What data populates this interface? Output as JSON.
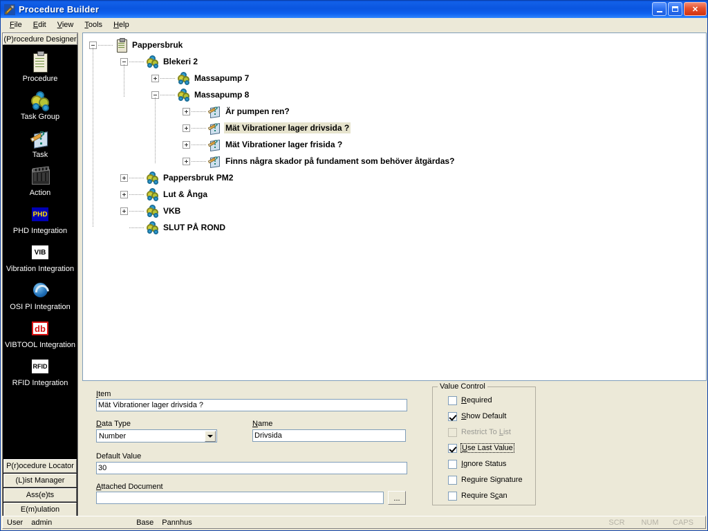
{
  "window": {
    "title": "Procedure Builder",
    "icon": "hammer-wrench-icon",
    "minimize_label": "Minimize",
    "maximize_label": "Restore",
    "close_label": "Close"
  },
  "menu": {
    "items": [
      {
        "name": "file",
        "label": "File",
        "accel": "F"
      },
      {
        "name": "edit",
        "label": "Edit",
        "accel": "E"
      },
      {
        "name": "view",
        "label": "View",
        "accel": "V"
      },
      {
        "name": "tools",
        "label": "Tools",
        "accel": "T"
      },
      {
        "name": "help",
        "label": "Help",
        "accel": "H"
      }
    ]
  },
  "sidebar": {
    "header": "(P)rocedure Designer",
    "items": [
      {
        "label": "Procedure",
        "icon": "procedure-clipboard-icon"
      },
      {
        "label": "Task Group",
        "icon": "task-group-gears-icon"
      },
      {
        "label": "Task",
        "icon": "task-pencil-question-icon"
      },
      {
        "label": "Action",
        "icon": "action-clapperboard-icon"
      },
      {
        "label": "PHD Integration",
        "icon": "phd-badge-icon"
      },
      {
        "label": "Vibration Integration",
        "icon": "vib-badge-icon"
      },
      {
        "label": "OSI PI Integration",
        "icon": "osi-pi-icon"
      },
      {
        "label": "VIBTOOL Integration",
        "icon": "db-badge-icon"
      },
      {
        "label": "RFID Integration",
        "icon": "rfid-badge-icon"
      }
    ],
    "footer_buttons": [
      {
        "label": "P(r)ocedure Locator"
      },
      {
        "label": "(L)ist Manager"
      },
      {
        "label": "Ass(e)ts"
      },
      {
        "label": "E(m)ulation"
      }
    ]
  },
  "tree": {
    "nodes": [
      {
        "label": "Pappersbruk",
        "depth": 0,
        "state": "expanded",
        "icon": "procedure-clipboard-icon",
        "selected": false
      },
      {
        "label": "Blekeri 2",
        "depth": 1,
        "state": "expanded",
        "icon": "task-group-gears-icon",
        "selected": false
      },
      {
        "label": "Massapump 7",
        "depth": 2,
        "state": "collapsed",
        "icon": "task-group-gears-icon",
        "selected": false
      },
      {
        "label": "Massapump 8",
        "depth": 2,
        "state": "expanded",
        "icon": "task-group-gears-icon",
        "selected": false
      },
      {
        "label": "Är pumpen ren?",
        "depth": 3,
        "state": "collapsed",
        "icon": "task-pencil-question-icon",
        "selected": false
      },
      {
        "label": "Mät Vibrationer lager drivsida ?",
        "depth": 3,
        "state": "collapsed",
        "icon": "task-pencil-question-icon",
        "selected": true
      },
      {
        "label": "Mät Vibrationer lager frisida ?",
        "depth": 3,
        "state": "collapsed",
        "icon": "task-pencil-question-icon",
        "selected": false
      },
      {
        "label": "Finns några skador på fundament som behöver åtgärdas?",
        "depth": 3,
        "state": "collapsed",
        "icon": "task-pencil-question-icon",
        "selected": false
      },
      {
        "label": "Pappersbruk PM2",
        "depth": 1,
        "state": "collapsed",
        "icon": "task-group-gears-icon",
        "selected": false
      },
      {
        "label": "Lut & Ånga",
        "depth": 1,
        "state": "collapsed",
        "icon": "task-group-gears-icon",
        "selected": false
      },
      {
        "label": "VKB",
        "depth": 1,
        "state": "collapsed",
        "icon": "task-group-gears-icon",
        "selected": false
      },
      {
        "label": "SLUT PÅ ROND",
        "depth": 1,
        "state": "leaf",
        "icon": "task-group-gears-icon",
        "selected": false
      }
    ]
  },
  "form": {
    "item_label": "Item",
    "item_accel": "I",
    "item_value": "Mät Vibrationer lager drivsida ?",
    "data_type_label": "Data Type",
    "data_type_accel": "D",
    "data_type_value": "Number",
    "name_label": "Name",
    "name_accel": "N",
    "name_value": "Drivsida",
    "default_value_label": "Default Value",
    "default_value": "30",
    "attached_document_label": "Attached Document",
    "attached_document_accel": "A",
    "attached_document_value": "",
    "browse_label": "..."
  },
  "value_control": {
    "title": "Value Control",
    "checkboxes": [
      {
        "label": "Required",
        "accel": "R",
        "checked": false,
        "disabled": false,
        "focused": false
      },
      {
        "label": "Show Default",
        "accel": "S",
        "checked": true,
        "disabled": false,
        "focused": false
      },
      {
        "label": "Restrict To List",
        "accel": "L",
        "checked": false,
        "disabled": true,
        "focused": false
      },
      {
        "label": "Use Last Value",
        "accel": "U",
        "checked": true,
        "disabled": false,
        "focused": true
      },
      {
        "label": "Ignore Status",
        "accel": "I",
        "checked": false,
        "disabled": false,
        "focused": false
      },
      {
        "label": "Require Signature",
        "accel": "q",
        "checked": false,
        "disabled": false,
        "focused": false
      },
      {
        "label": "Require Scan",
        "accel": "c",
        "checked": false,
        "disabled": false,
        "focused": false
      }
    ]
  },
  "statusbar": {
    "user_label": "User",
    "user_value": "admin",
    "base_label": "Base",
    "base_value": "Pannhus",
    "indicators": [
      "SCR",
      "NUM",
      "CAPS"
    ]
  },
  "colors": {
    "titlebar_blue": "#0a55df",
    "face": "#ece9d8",
    "selection": "#e6e3cd",
    "sidebar_bg": "#000000"
  }
}
